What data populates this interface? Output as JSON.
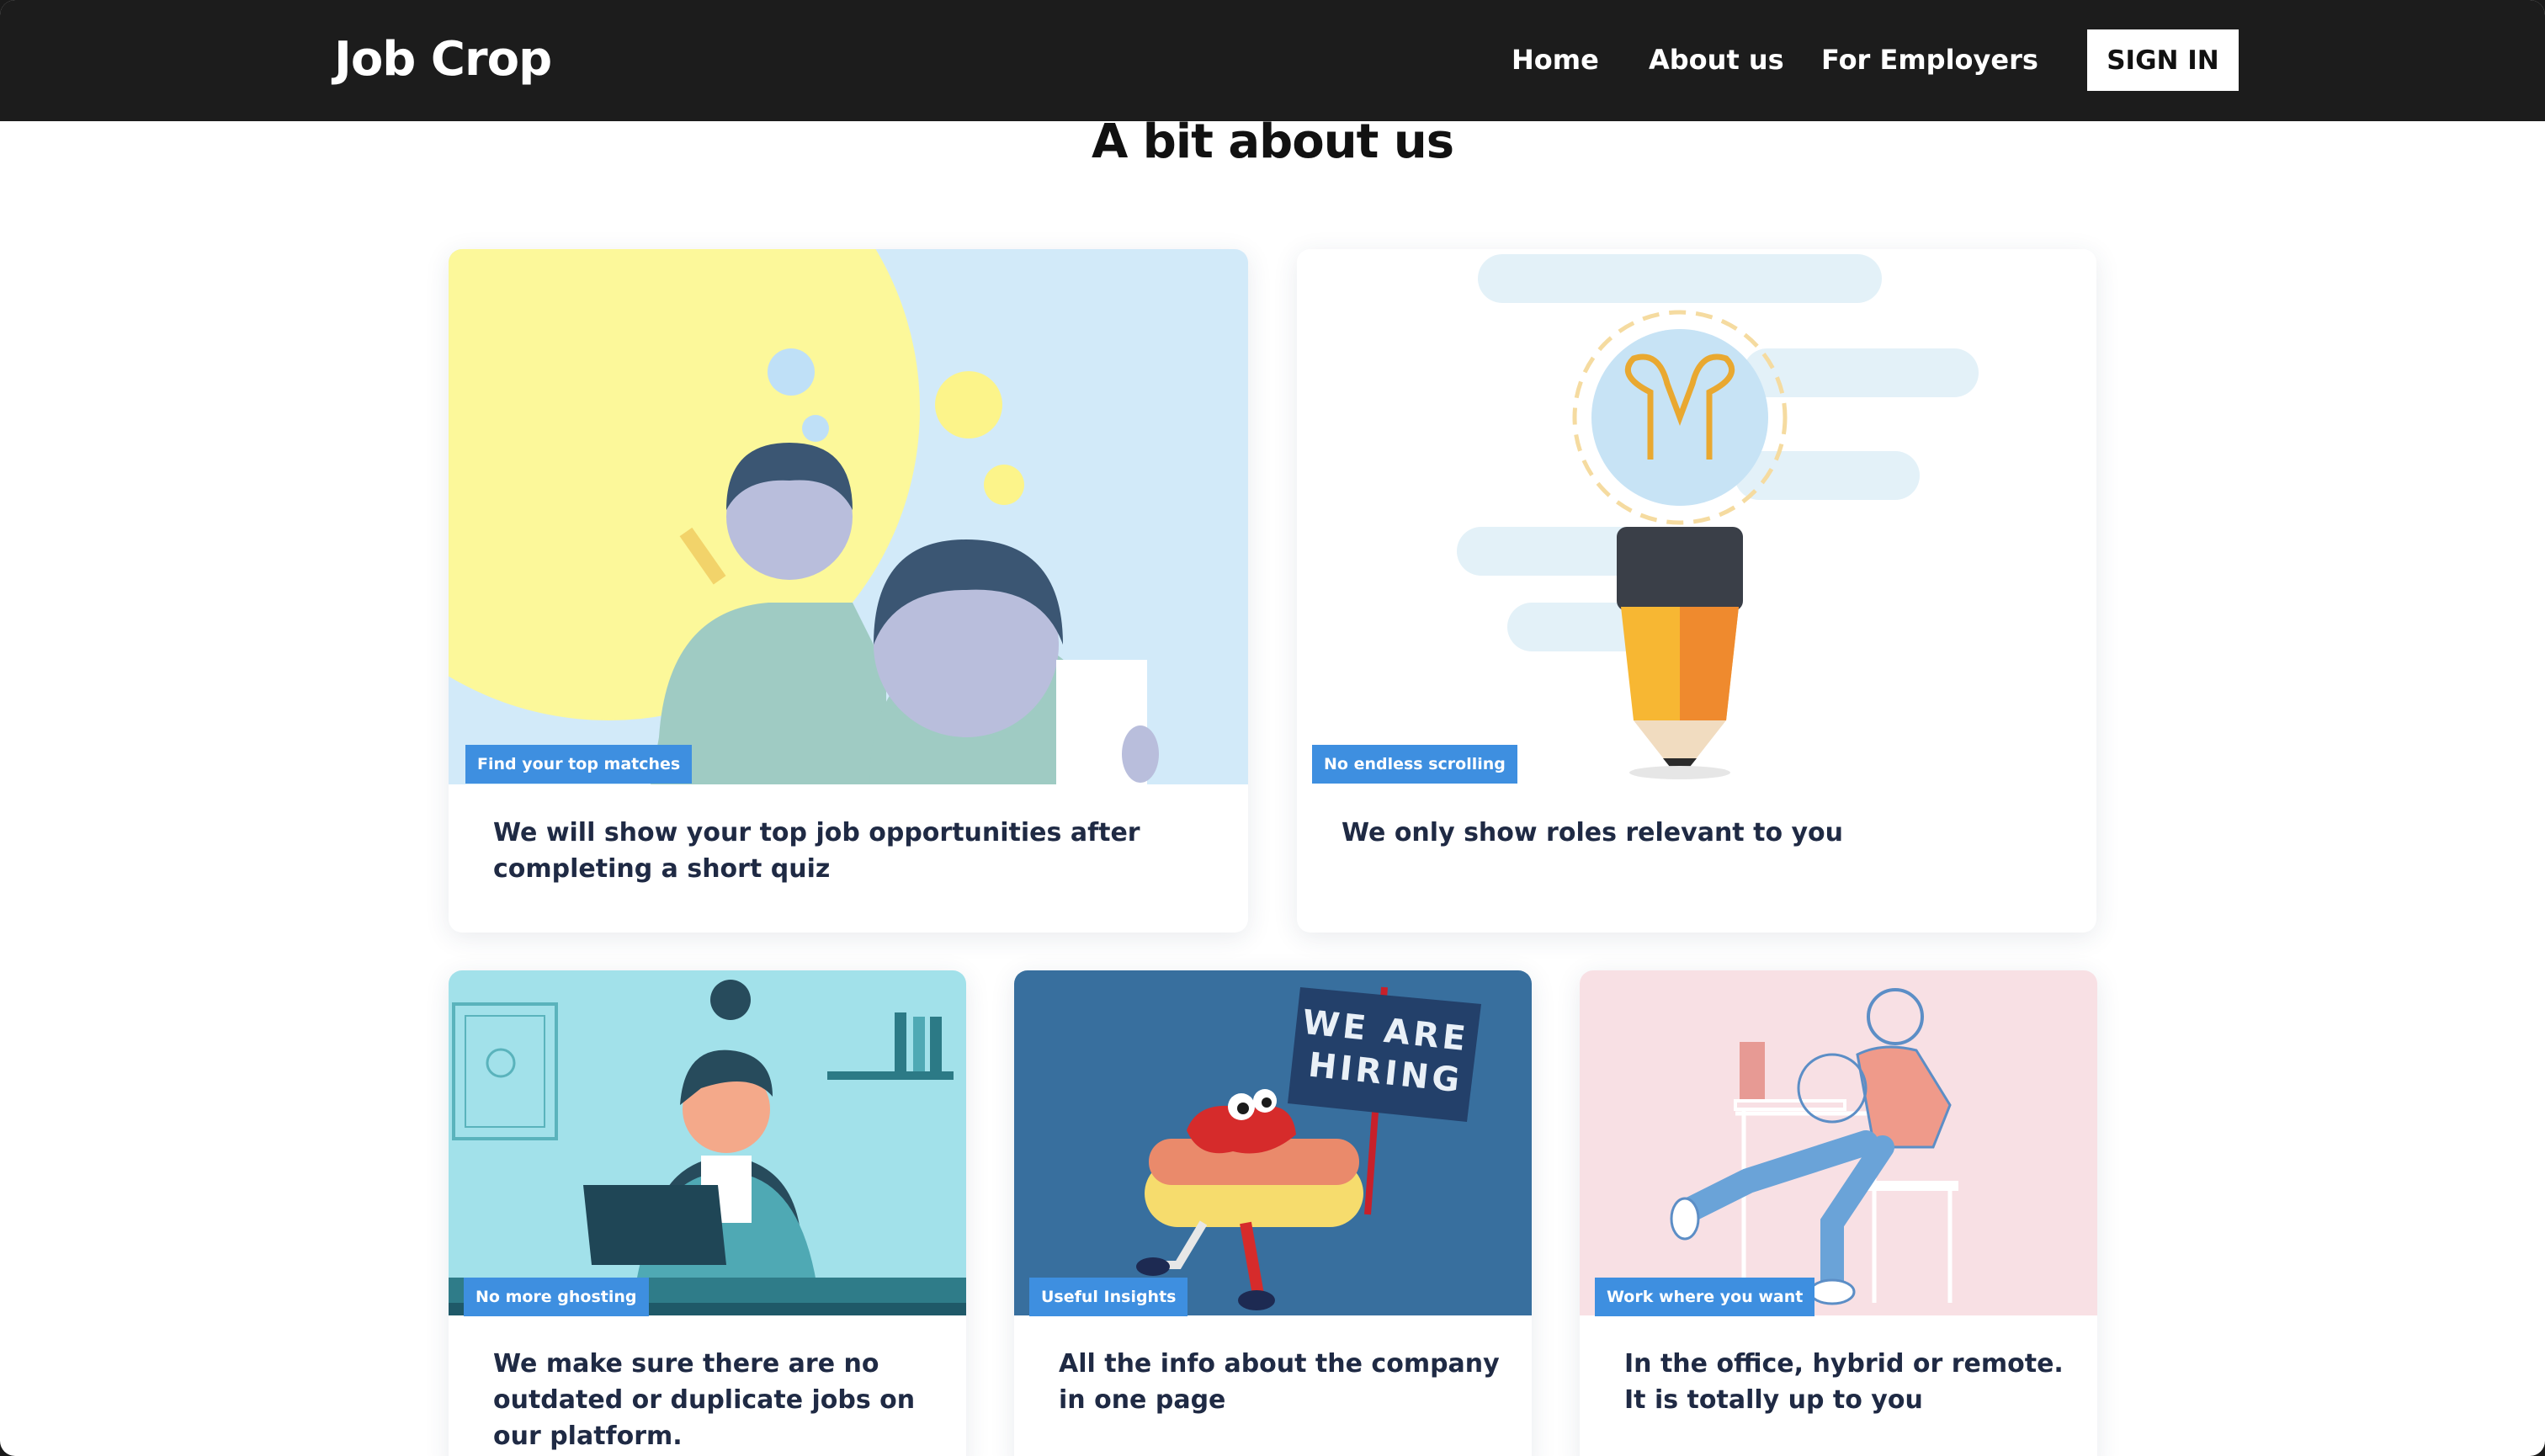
{
  "brand": "Job Crop",
  "nav": {
    "home": "Home",
    "about": "About us",
    "employers": "For Employers",
    "signin": "SIGN IN"
  },
  "heading": "A bit about us",
  "cards": [
    {
      "tag": "Find your top matches",
      "text": "We will show your top job opportunities after completing a short quiz",
      "illustration": "quiz-illustration"
    },
    {
      "tag": "No endless scrolling",
      "text": "We only show roles relevant to you",
      "illustration": "lightbulb-pencil-illustration"
    },
    {
      "tag": "No more ghosting",
      "text": "We make sure there are no outdated or duplicate jobs on our platform.",
      "illustration": "woman-laptop-illustration"
    },
    {
      "tag": "Useful Insights",
      "text": "All the info about the company in one page",
      "illustration": "hotdog-hiring-illustration",
      "sign_text": "WE ARE HIRING"
    },
    {
      "tag": "Work where you want",
      "text": "In the office, hybrid or remote. It is totally up to you",
      "illustration": "remote-work-illustration"
    }
  ],
  "colors": {
    "navbar": "#1c1c1c",
    "tag": "#3e8fe0",
    "card_text": "#1f2a44"
  }
}
